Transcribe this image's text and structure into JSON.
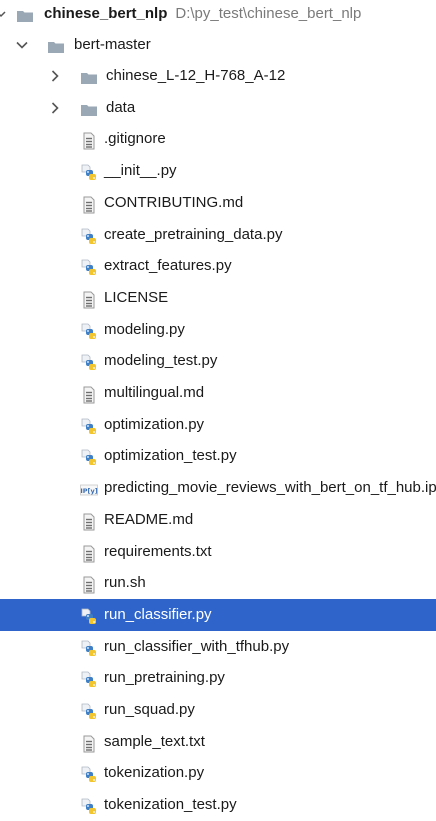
{
  "project": {
    "name": "chinese_bert_nlp",
    "path": "D:\\py_test\\chinese_bert_nlp"
  },
  "root_folder": {
    "name": "bert-master"
  },
  "subfolders": [
    {
      "name": "chinese_L-12_H-768_A-12",
      "icon": "folder-icon"
    },
    {
      "name": "data",
      "icon": "folder-icon"
    }
  ],
  "files": [
    {
      "name": ".gitignore",
      "icon": "text-file-icon"
    },
    {
      "name": "__init__.py",
      "icon": "python-file-icon"
    },
    {
      "name": "CONTRIBUTING.md",
      "icon": "text-file-icon"
    },
    {
      "name": "create_pretraining_data.py",
      "icon": "python-file-icon"
    },
    {
      "name": "extract_features.py",
      "icon": "python-file-icon"
    },
    {
      "name": "LICENSE",
      "icon": "text-file-icon"
    },
    {
      "name": "modeling.py",
      "icon": "python-file-icon"
    },
    {
      "name": "modeling_test.py",
      "icon": "python-file-icon"
    },
    {
      "name": "multilingual.md",
      "icon": "text-file-icon"
    },
    {
      "name": "optimization.py",
      "icon": "python-file-icon"
    },
    {
      "name": "optimization_test.py",
      "icon": "python-file-icon"
    },
    {
      "name": "predicting_movie_reviews_with_bert_on_tf_hub.ipynb",
      "icon": "notebook-file-icon"
    },
    {
      "name": "README.md",
      "icon": "text-file-icon"
    },
    {
      "name": "requirements.txt",
      "icon": "text-file-icon"
    },
    {
      "name": "run.sh",
      "icon": "text-file-icon"
    },
    {
      "name": "run_classifier.py",
      "icon": "python-file-icon",
      "selected": true
    },
    {
      "name": "run_classifier_with_tfhub.py",
      "icon": "python-file-icon"
    },
    {
      "name": "run_pretraining.py",
      "icon": "python-file-icon"
    },
    {
      "name": "run_squad.py",
      "icon": "python-file-icon"
    },
    {
      "name": "sample_text.txt",
      "icon": "text-file-icon"
    },
    {
      "name": "tokenization.py",
      "icon": "python-file-icon"
    },
    {
      "name": "tokenization_test.py",
      "icon": "python-file-icon"
    }
  ],
  "colors": {
    "selection": "#2f65ca",
    "folder": "#9aa7b4",
    "text_file_lines": "#7c7c7c",
    "python_blue": "#3f7fc6",
    "python_yellow": "#f2c52f",
    "path_text": "#7a7a7a"
  }
}
